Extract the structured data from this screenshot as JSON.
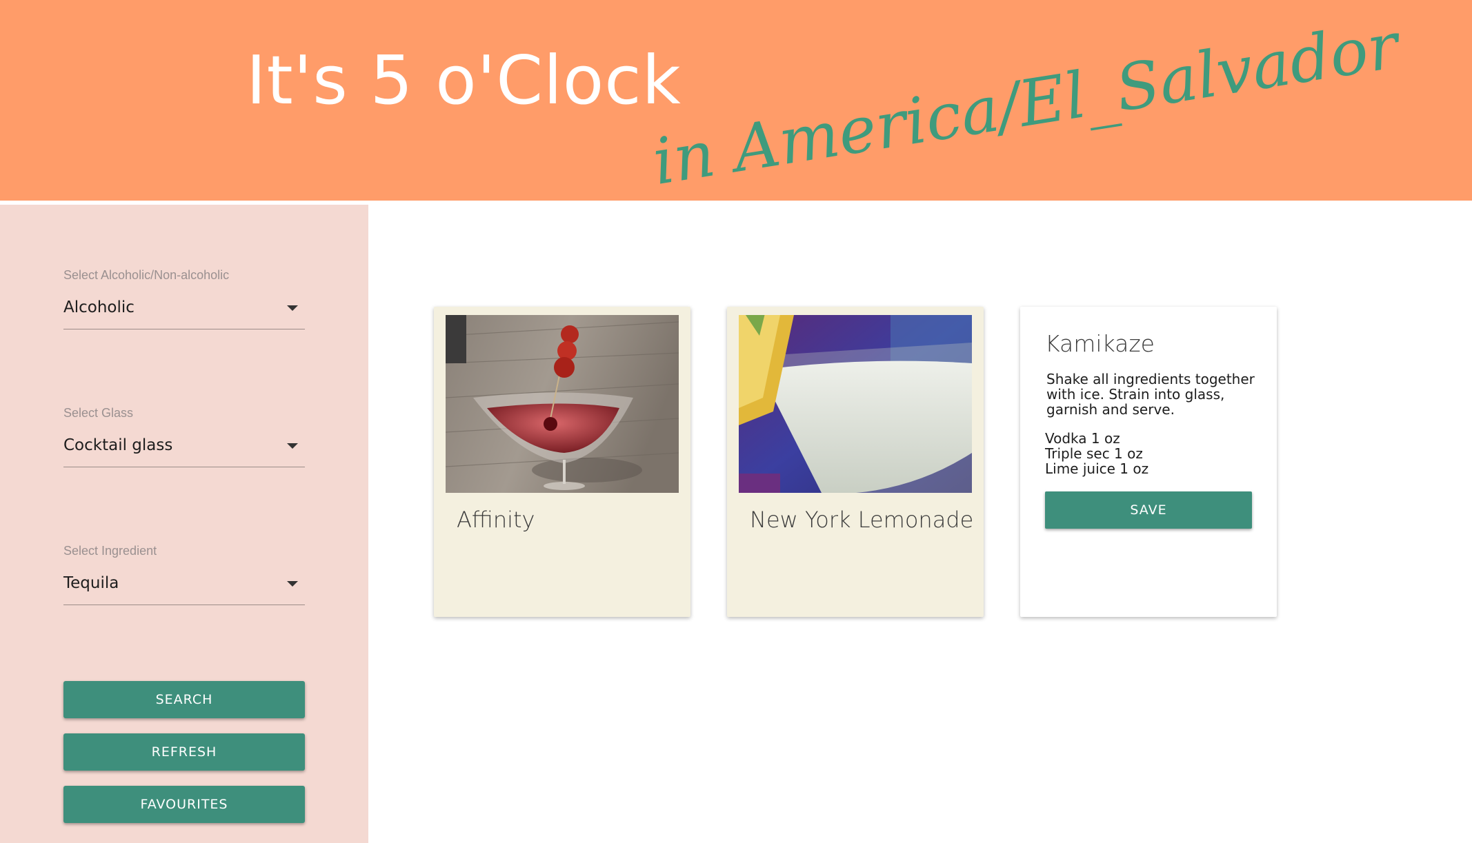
{
  "header": {
    "title": "It's 5 o'Clock",
    "timezone_text": "in America/El_Salvador"
  },
  "sidebar": {
    "fields": [
      {
        "label": "Select Alcoholic/Non-alcoholic",
        "value": "Alcoholic"
      },
      {
        "label": "Select Glass",
        "value": "Cocktail glass"
      },
      {
        "label": "Select Ingredient",
        "value": "Tequila"
      }
    ],
    "buttons": {
      "search": "SEARCH",
      "refresh": "REFRESH",
      "favourites": "FAVOURITES"
    }
  },
  "cards": [
    {
      "title": "Affinity",
      "image": "cocktail-with-cherries-photo"
    },
    {
      "title": "New York Lemonade",
      "image": "cocktail-with-pineapple-photo"
    }
  ],
  "detail": {
    "title": "Kamikaze",
    "instructions": "Shake all ingredients together with ice. Strain into glass, garnish and serve.",
    "ingredients": [
      "Vodka 1 oz",
      "Triple sec 1 oz",
      "Lime juice 1 oz"
    ],
    "save_label": "SAVE"
  },
  "colors": {
    "header_bg": "#ff9c69",
    "accent": "#3e8f7c",
    "sidebar_bg": "#f4d9d2",
    "card_bg": "#f4f0df"
  }
}
